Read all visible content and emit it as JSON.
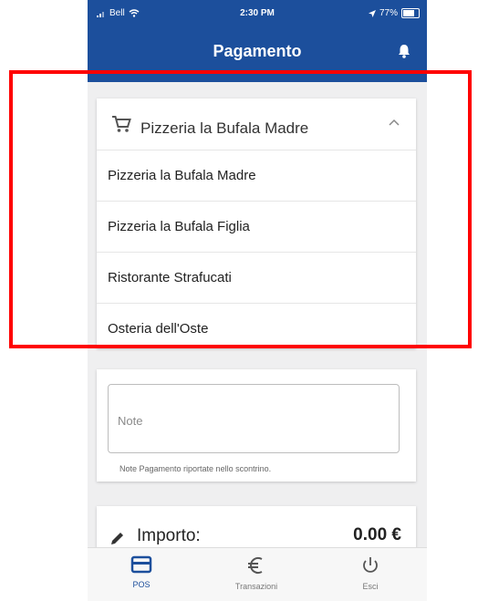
{
  "status_bar": {
    "carrier": "Bell",
    "time": "2:30 PM",
    "battery": "77%"
  },
  "header": {
    "title": "Pagamento"
  },
  "restaurant_select": {
    "selected": "Pizzeria la Bufala Madre",
    "options": [
      "Pizzeria la Bufala Madre",
      "Pizzeria la Bufala Figlia",
      "Ristorante Strafucati",
      "Osteria dell'Oste"
    ]
  },
  "note": {
    "placeholder": "Note",
    "hint": "Note Pagamento riportate nello scontrino."
  },
  "amount": {
    "label": "Importo:",
    "value": "0.00 €"
  },
  "bottom_nav": {
    "items": [
      {
        "label": "POS",
        "icon": "card-icon",
        "active": true
      },
      {
        "label": "Transazioni",
        "icon": "euro-icon",
        "active": false
      },
      {
        "label": "Esci",
        "icon": "power-icon",
        "active": false
      }
    ]
  },
  "colors": {
    "primary": "#1c4f9c",
    "highlight": "#ff0000"
  }
}
